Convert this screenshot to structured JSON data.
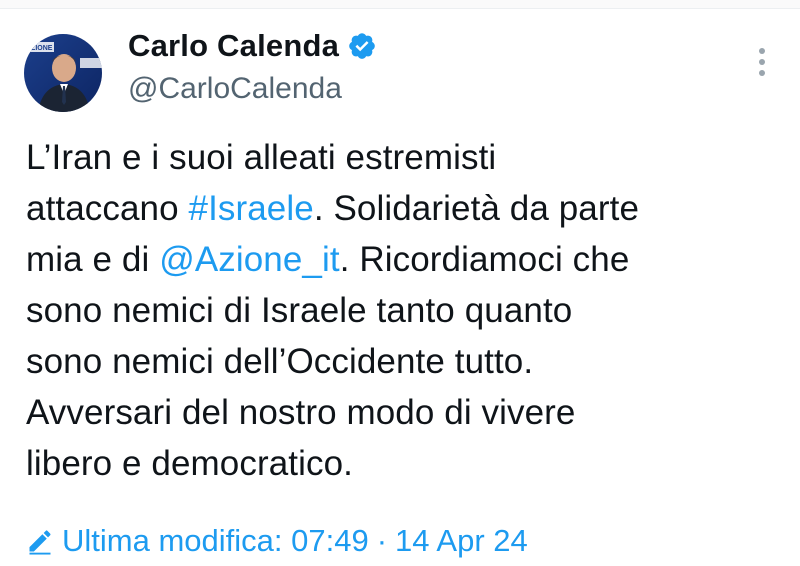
{
  "author": {
    "display_name": "Carlo Calenda",
    "handle": "@CarloCalenda",
    "verified_icon": "verified-badge-icon",
    "avatar_icon": "avatar",
    "avatar_logo_text": "AZIONE"
  },
  "tweet": {
    "lines": [
      [
        {
          "text": "L’Iran e i suoi alleati estremisti",
          "type": "text"
        }
      ],
      [
        {
          "text": "attaccano ",
          "type": "text"
        },
        {
          "text": "#Israele",
          "type": "hashtag"
        },
        {
          "text": ". Solidarietà da parte",
          "type": "text"
        }
      ],
      [
        {
          "text": "mia e di ",
          "type": "text"
        },
        {
          "text": "@Azione_it",
          "type": "mention"
        },
        {
          "text": ". Ricordiamoci che",
          "type": "text"
        }
      ],
      [
        {
          "text": "sono nemici di Israele tanto quanto",
          "type": "text"
        }
      ],
      [
        {
          "text": "sono nemici dell’Occidente tutto.",
          "type": "text"
        }
      ],
      [
        {
          "text": "Avversari del nostro modo di vivere",
          "type": "text"
        }
      ],
      [
        {
          "text": "libero e democratico.",
          "type": "text"
        }
      ]
    ]
  },
  "meta": {
    "edited_label": "Ultima modifica: 07:49",
    "separator": "·",
    "date": "14 Apr 24",
    "edit_icon": "pencil-icon"
  },
  "colors": {
    "text": "#0f1419",
    "secondary": "#536471",
    "link": "#1d9bf0",
    "verified": "#1d9bf0"
  }
}
